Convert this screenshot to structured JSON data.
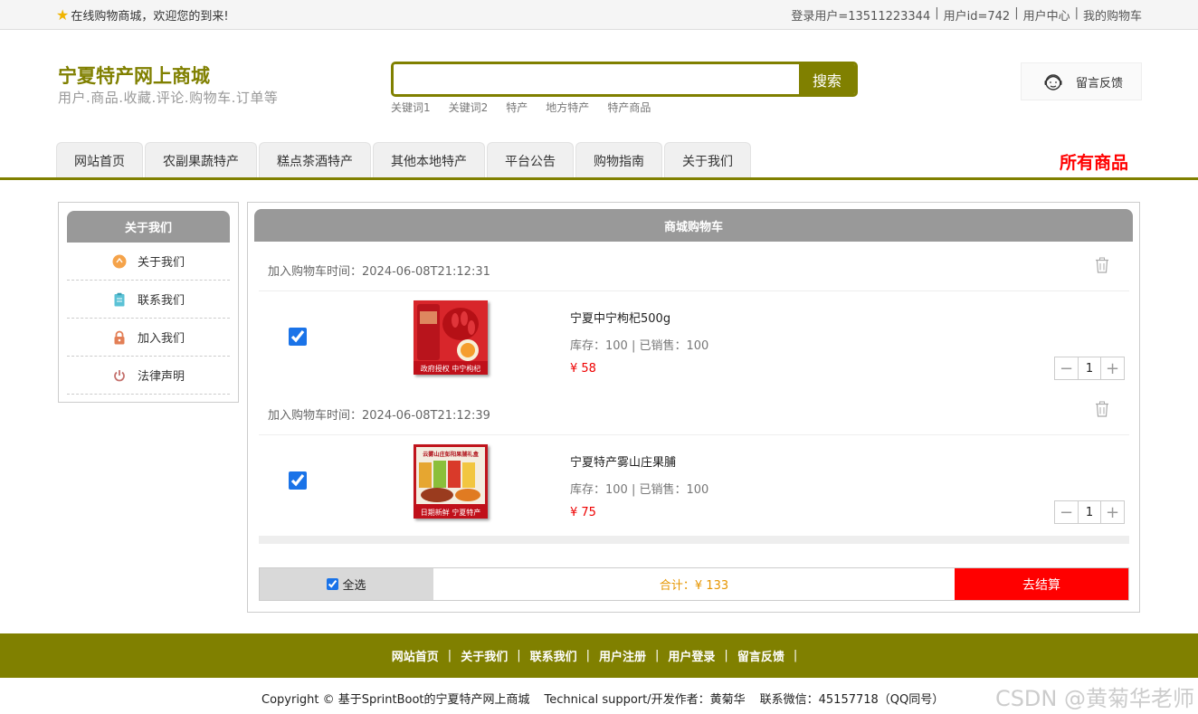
{
  "topbar": {
    "welcome": "在线购物商城，欢迎您的到来!",
    "links": [
      "登录用户=13511223344",
      "用户id=742",
      "用户中心",
      "我的购物车"
    ]
  },
  "header": {
    "title": "宁夏特产网上商城",
    "subtitle": "用户.商品.收藏.评论.购物车.订单等",
    "search_value": "",
    "search_button": "搜索",
    "keywords": [
      "关键词1",
      "关键词2",
      "特产",
      "地方特产",
      "特产商品"
    ],
    "feedback": "留言反馈"
  },
  "nav": {
    "tabs": [
      "网站首页",
      "农副果蔬特产",
      "糕点茶酒特产",
      "其他本地特产",
      "平台公告",
      "购物指南",
      "关于我们"
    ],
    "all_goods": "所有商品"
  },
  "sidebar": {
    "title": "关于我们",
    "items": [
      {
        "label": "关于我们",
        "icon": "orange-circle-icon"
      },
      {
        "label": "联系我们",
        "icon": "clipboard-icon"
      },
      {
        "label": "加入我们",
        "icon": "lock-icon"
      },
      {
        "label": "法律声明",
        "icon": "power-icon"
      }
    ]
  },
  "cart": {
    "title": "商城购物车",
    "items": [
      {
        "time": "加入购物车时间：2024-06-08T21:12:31",
        "name": "宁夏中宁枸杞500g",
        "stock": "库存：100 | 已销售：100",
        "price": "¥ 58",
        "quantity": "1",
        "checked": true,
        "thumb_caption": "政府授权 中宁枸杞"
      },
      {
        "time": "加入购物车时间：2024-06-08T21:12:39",
        "name": "宁夏特产雾山庄果脯",
        "stock": "库存：100 | 已销售：100",
        "price": "¥ 75",
        "quantity": "1",
        "checked": true,
        "thumb_caption": "日期新鲜 宁夏特产",
        "thumb_title": "云雾山庄彭阳果脯礼盒"
      }
    ],
    "select_all": "全选",
    "total": "合计：¥ 133",
    "checkout": "去结算"
  },
  "footer": {
    "links": [
      "网站首页",
      "关于我们",
      "联系我们",
      "用户注册",
      "用户登录",
      "留言反馈"
    ],
    "copyright": "Copyright © 基于SprintBoot的宁夏特产网上商城",
    "support": "Technical support/开发作者：黄菊华",
    "contact": "联系微信：45157718（QQ同号）"
  },
  "watermark": "CSDN @黄菊华老师",
  "colors": {
    "brand": "#808000",
    "accent": "#ff0000",
    "header_gray": "#999999"
  }
}
